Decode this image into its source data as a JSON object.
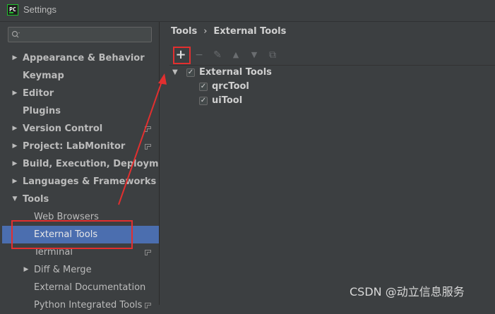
{
  "window": {
    "title": "Settings",
    "app_icon_text": "PC"
  },
  "sidebar": {
    "search": {
      "placeholder": "",
      "value": ""
    },
    "items": [
      {
        "label": "Appearance & Behavior",
        "arrow": "▶",
        "badge": false
      },
      {
        "label": "Keymap",
        "arrow": "",
        "badge": false
      },
      {
        "label": "Editor",
        "arrow": "▶",
        "badge": false
      },
      {
        "label": "Plugins",
        "arrow": "",
        "badge": false
      },
      {
        "label": "Version Control",
        "arrow": "▶",
        "badge": true
      },
      {
        "label": "Project: LabMonitor",
        "arrow": "▶",
        "badge": true
      },
      {
        "label": "Build, Execution, Deployment",
        "arrow": "▶",
        "badge": false
      },
      {
        "label": "Languages & Frameworks",
        "arrow": "▶",
        "badge": false
      },
      {
        "label": "Tools",
        "arrow": "▼",
        "badge": false
      },
      {
        "label": "Web Browsers",
        "arrow": "",
        "badge": false
      },
      {
        "label": "External Tools",
        "arrow": "",
        "badge": false,
        "selected": true
      },
      {
        "label": "Terminal",
        "arrow": "",
        "badge": true
      },
      {
        "label": "Diff & Merge",
        "arrow": "▶",
        "badge": false
      },
      {
        "label": "External Documentation",
        "arrow": "",
        "badge": false
      },
      {
        "label": "Python Integrated Tools",
        "arrow": "",
        "badge": true
      }
    ]
  },
  "main": {
    "breadcrumb": [
      "Tools",
      "›",
      "External Tools"
    ],
    "toolbar": {
      "add": "+",
      "remove": "−",
      "edit": "✎",
      "up": "▲",
      "down": "▼",
      "copy": "⧉"
    },
    "tree": {
      "group": {
        "label": "External Tools",
        "checked": true,
        "expanded_arrow": "▼",
        "check_mark": "✓"
      },
      "children": [
        {
          "label": "qrcTool",
          "checked": true,
          "check_mark": "✓"
        },
        {
          "label": "uiTool",
          "checked": true,
          "check_mark": "✓"
        }
      ]
    }
  },
  "watermark": "CSDN @动立信息服务",
  "colors": {
    "selection": "#4b6eaf",
    "annotation": "#e22f2f",
    "background": "#3c3f41"
  }
}
